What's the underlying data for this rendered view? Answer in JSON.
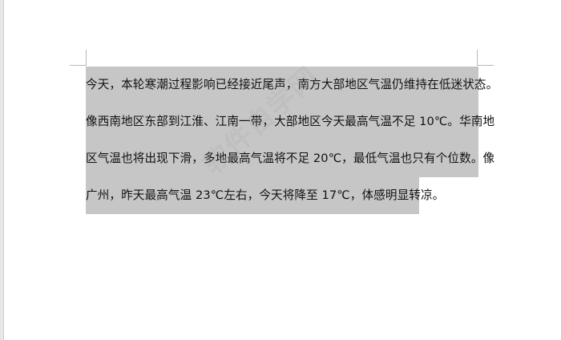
{
  "document": {
    "lines": [
      "今天，本轮寒潮过程影响已经接近尾声，南方大部地区气温仍维持在低迷状态。",
      "像西南地区东部到江淮、江南一带，大部地区今天最高气温不足 10℃。华南地",
      "区气温也将出现下滑，多地最高气温将不足 20℃，最低气温也只有个位数。像",
      "广州，昨天最高气温 23℃左右，今天将降至 17℃，体感明显转凉。"
    ],
    "watermark": "软件自学网"
  },
  "colors": {
    "selection": "#c6c6c6",
    "page_background": "#ffffff",
    "text": "#111111"
  }
}
